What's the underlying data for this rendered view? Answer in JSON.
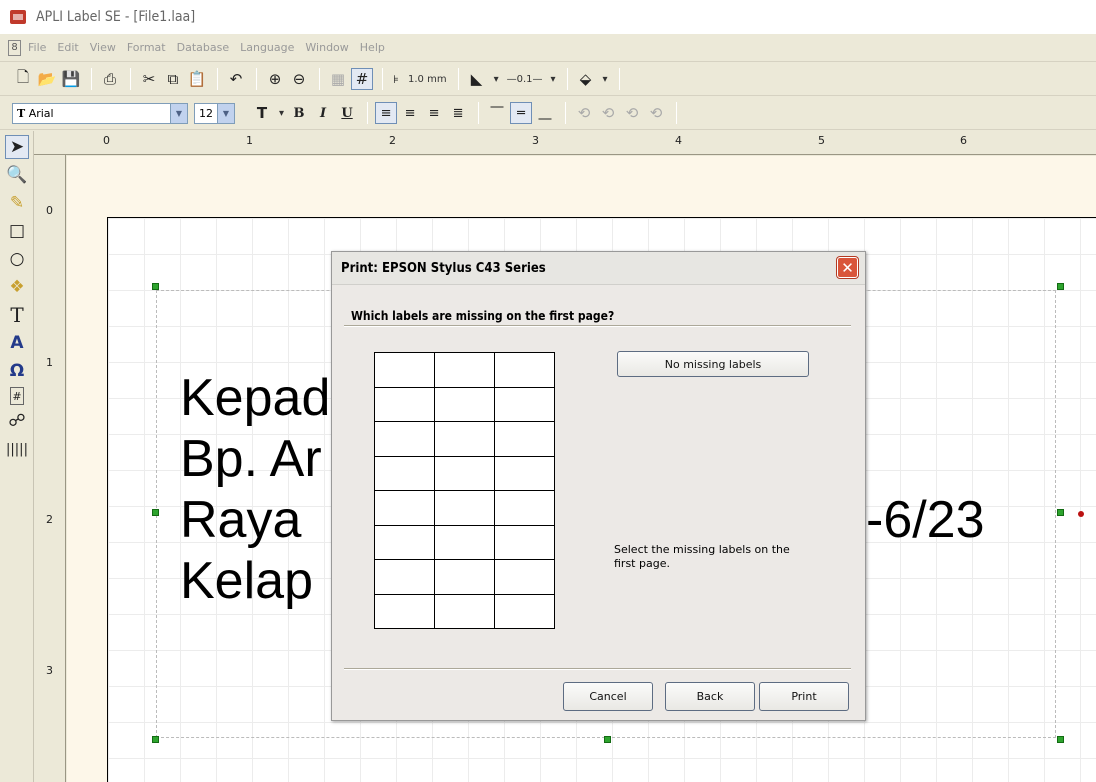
{
  "window": {
    "title": "APLI Label SE - [File1.laa]"
  },
  "menu": [
    "File",
    "Edit",
    "View",
    "Format",
    "Database",
    "Language",
    "Window",
    "Help"
  ],
  "toolbar1": {
    "grid_size": "1.0 mm",
    "line_width": "—0.1—"
  },
  "toolbar2": {
    "font_name": "Arial",
    "font_size": "12"
  },
  "ruler": {
    "top": [
      "0",
      "1",
      "2",
      "3",
      "4",
      "5",
      "6"
    ],
    "left": [
      "0",
      "1",
      "2",
      "3"
    ]
  },
  "label": {
    "lines": [
      "Kepad",
      "Bp. Ar",
      "Raya",
      "Kelap"
    ],
    "line3_tail": "-6/23"
  },
  "dialog": {
    "title": "Print: EPSON Stylus C43 Series",
    "question": "Which labels are missing on the first page?",
    "no_missing_button": "No missing labels",
    "hint": "Select the missing labels on the first page.",
    "cancel_button": "Cancel",
    "back_button": "Back",
    "print_button": "Print",
    "grid": {
      "rows": 8,
      "cols": 3
    }
  },
  "colors": {
    "handle": "#2ea42e",
    "close": "#d9553a",
    "canvas": "#fdf7e9"
  }
}
